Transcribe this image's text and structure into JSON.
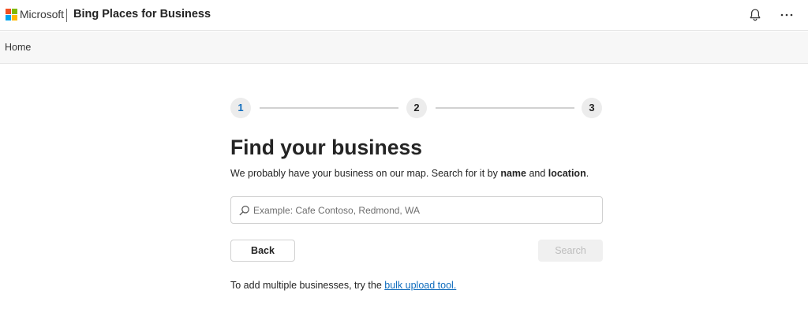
{
  "header": {
    "brand": "Microsoft",
    "product": "Bing Places for Business",
    "icons": [
      "notification-bell-icon",
      "more-options-icon"
    ]
  },
  "nav": {
    "home_label": "Home"
  },
  "stepper": {
    "steps": [
      "1",
      "2",
      "3"
    ],
    "current_step": 1,
    "active_color": "#0f6cbd"
  },
  "main": {
    "title": "Find your business",
    "subtitle_prefix": "We probably have your business on our map. Search for it by ",
    "subtitle_bold_1": "name",
    "subtitle_and": " and ",
    "subtitle_bold_2": "location",
    "subtitle_suffix": ".",
    "search": {
      "value": "",
      "placeholder": "Example: Cafe Contoso, Redmond, WA"
    },
    "back_label": "Back",
    "search_label": "Search",
    "footer_prefix": "To add multiple businesses, try the ",
    "footer_link": "bulk upload tool."
  },
  "colors": {
    "ms_red": "#f25022",
    "ms_green": "#7fba00",
    "ms_blue": "#00a4ef",
    "ms_yellow": "#ffb900",
    "link": "#0f6cbd"
  }
}
